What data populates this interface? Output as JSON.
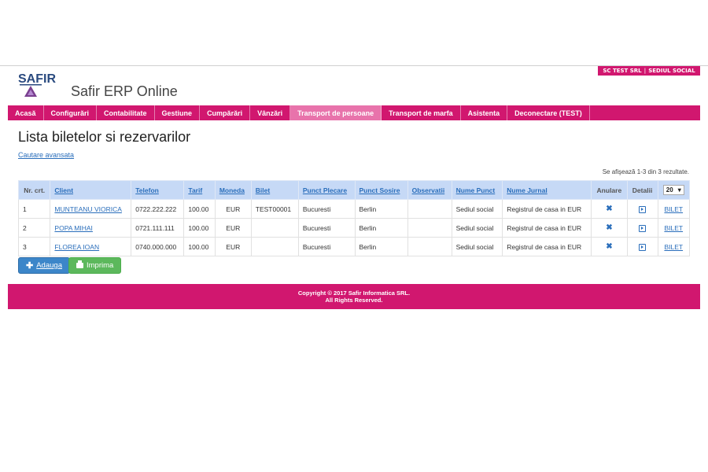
{
  "header": {
    "company": "SC TEST SRL",
    "location": "SEDIUL SOCIAL",
    "logo_text": "SAFIR",
    "app_title": "Safir ERP Online"
  },
  "nav": {
    "items": [
      {
        "label": "Acasă"
      },
      {
        "label": "Configurări"
      },
      {
        "label": "Contabilitate"
      },
      {
        "label": "Gestiune"
      },
      {
        "label": "Cumpărări"
      },
      {
        "label": "Vânzări"
      },
      {
        "label": "Transport de persoane"
      },
      {
        "label": "Transport de marfa"
      },
      {
        "label": "Asistenta"
      },
      {
        "label": "Deconectare (TEST)"
      }
    ],
    "active": "Transport de persoane"
  },
  "main": {
    "title": "Lista biletelor si rezervarilor",
    "advanced_search": "Cautare avansata",
    "results_info": "Se afişează 1-3 din 3 rezultate.",
    "page_size": "20"
  },
  "table": {
    "columns": [
      "Nr. crt.",
      "Client",
      "Telefon",
      "Tarif",
      "Moneda",
      "Bilet",
      "Punct Plecare",
      "Punct Sosire",
      "Observatii",
      "Nume Punct",
      "Nume Jurnal",
      "Anulare",
      "Detalii"
    ],
    "rows": [
      {
        "nr": "1",
        "client": "MUNTEANU VIORICA",
        "telefon": "0722.222.222",
        "tarif": "100.00",
        "moneda": "EUR",
        "bilet": "TEST00001",
        "plecare": "Bucuresti",
        "sosire": "Berlin",
        "observatii": "",
        "punct": "Sediul social",
        "jurnal": "Registrul de casa in EUR",
        "action": "BILET"
      },
      {
        "nr": "2",
        "client": "POPA MIHAI",
        "telefon": "0721.111.111",
        "tarif": "100.00",
        "moneda": "EUR",
        "bilet": "",
        "plecare": "Bucuresti",
        "sosire": "Berlin",
        "observatii": "",
        "punct": "Sediul social",
        "jurnal": "Registrul de casa in EUR",
        "action": "BILET"
      },
      {
        "nr": "3",
        "client": "FLOREA IOAN",
        "telefon": "0740.000.000",
        "tarif": "100.00",
        "moneda": "EUR",
        "bilet": "",
        "plecare": "Bucuresti",
        "sosire": "Berlin",
        "observatii": "",
        "punct": "Sediul social",
        "jurnal": "Registrul de casa in EUR",
        "action": "BILET"
      }
    ]
  },
  "buttons": {
    "add": "Adauga",
    "print": "Imprima"
  },
  "footer": {
    "line1": "Copyright © 2017 Safir Informatica SRL.",
    "line2": "All Rights Reserved."
  },
  "colors": {
    "brand": "#d1176f",
    "nav_active": "#e873ab",
    "table_header": "#c6d9f6",
    "link": "#2a6ebb",
    "add_button": "#3c86c9",
    "print_button": "#5cb85c"
  },
  "icons": {
    "cancel": "x-icon",
    "details": "details-icon",
    "add": "plus-icon",
    "print": "printer-icon"
  }
}
